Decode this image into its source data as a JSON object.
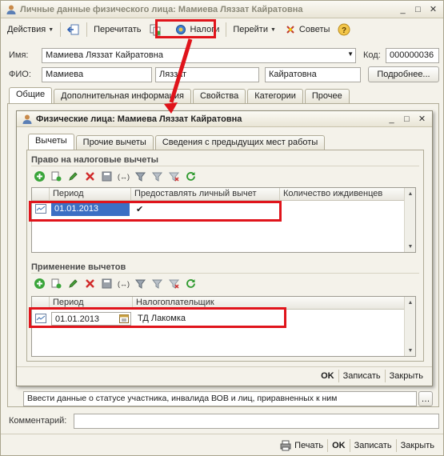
{
  "window": {
    "title": "Личные данные физического лица: Мамиева Ляззат Кайратовна"
  },
  "toolbar": {
    "actions_label": "Действия",
    "reread_label": "Перечитать",
    "taxes_label": "Налоги",
    "goto_label": "Перейти",
    "tips_label": "Советы"
  },
  "form": {
    "name_label": "Имя:",
    "name_value": "Мамиева Ляззат Кайратовна",
    "code_label": "Код:",
    "code_value": "000000036",
    "fio_label": "ФИО:",
    "last_name": "Мамиева",
    "first_name": "Ляззат",
    "patronymic": "Кайратовна",
    "more_button": "Подробнее..."
  },
  "main_tabs": [
    "Общие",
    "Дополнительная информация",
    "Свойства",
    "Категории",
    "Прочее"
  ],
  "dialog": {
    "title": "Физические лица: Мамиева Ляззат Кайратовна",
    "tabs": [
      "Вычеты",
      "Прочие вычеты",
      "Сведения с предыдущих мест работы"
    ],
    "section1": {
      "title": "Право на налоговые вычеты",
      "columns": [
        "Период",
        "Предоставлять личный вычет",
        "Количество иждивенцев"
      ],
      "rows": [
        {
          "period": "01.01.2013",
          "personal": "✔",
          "dependents": ""
        }
      ]
    },
    "section2": {
      "title": "Применение вычетов",
      "columns": [
        "Период",
        "Налогоплательщик"
      ],
      "rows": [
        {
          "period": "01.01.2013",
          "taxpayer": "ТД Лакомка"
        }
      ]
    },
    "ok_label": "OK",
    "save_label": "Записать",
    "close_label": "Закрыть"
  },
  "status_text": "Ввести данные о статусе участника, инвалида ВОВ и лиц, приравненных к ним",
  "comment_label": "Комментарий:",
  "comment_value": "",
  "footer": {
    "print_label": "Печать",
    "ok_label": "OK",
    "save_label": "Записать",
    "close_label": "Закрыть"
  }
}
